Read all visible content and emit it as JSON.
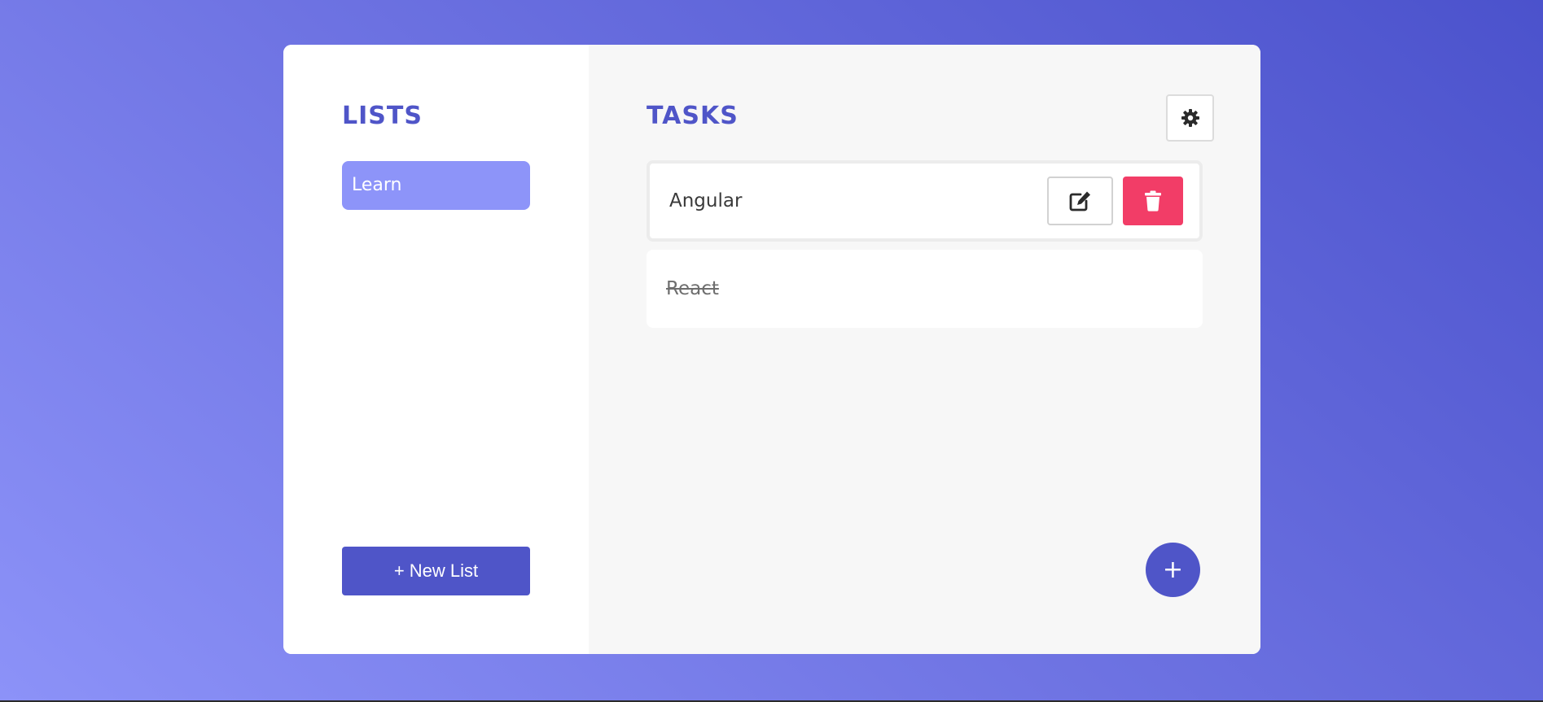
{
  "lists_panel": {
    "title": "LISTS",
    "items": [
      {
        "label": "Learn",
        "active": true
      }
    ],
    "new_list_label": "+ New List"
  },
  "tasks_panel": {
    "title": "TASKS",
    "settings_icon": "gear-icon",
    "tasks": [
      {
        "text": "Angular",
        "completed": false,
        "selected": true,
        "edit_icon": "edit-icon",
        "delete_icon": "trash-icon"
      },
      {
        "text": "React",
        "completed": true,
        "selected": false
      }
    ],
    "add_button_label": "+"
  },
  "colors": {
    "accent": "#4f55c8",
    "active_list": "#8d94f9",
    "delete": "#f23d67",
    "main_bg": "#f7f7f7"
  }
}
